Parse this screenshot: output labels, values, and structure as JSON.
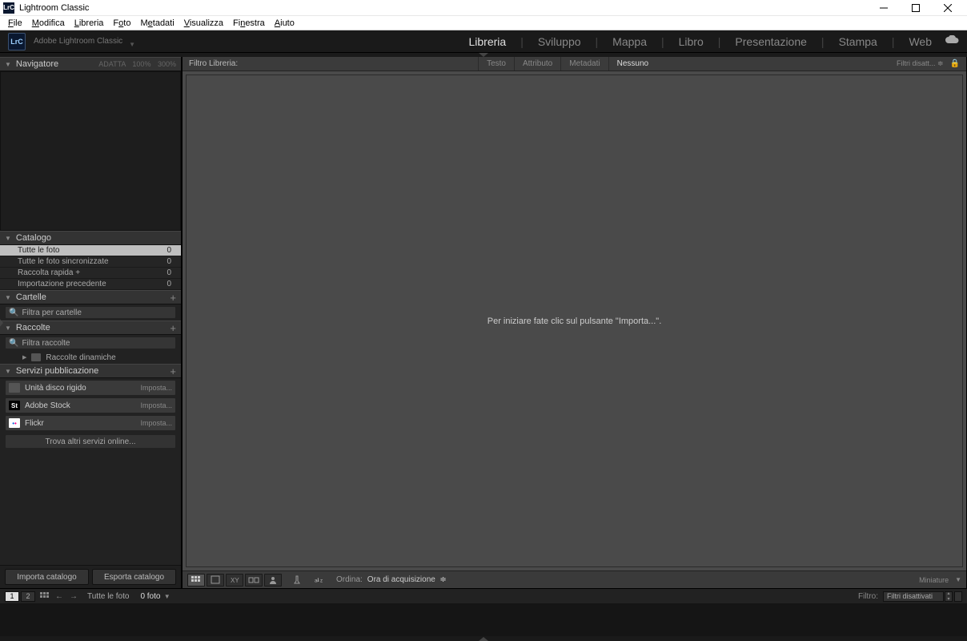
{
  "title": "Lightroom Classic",
  "menu": [
    "File",
    "Modifica",
    "Libreria",
    "Foto",
    "Metadati",
    "Visualizza",
    "Finestra",
    "Aiuto"
  ],
  "app_name": "Adobe Lightroom Classic",
  "modules": [
    "Libreria",
    "Sviluppo",
    "Mappa",
    "Libro",
    "Presentazione",
    "Stampa",
    "Web"
  ],
  "active_module": "Libreria",
  "navigator": {
    "title": "Navigatore",
    "zoom": [
      "ADATTA",
      "100%",
      "300%"
    ]
  },
  "catalog": {
    "title": "Catalogo",
    "items": [
      {
        "label": "Tutte le foto",
        "count": "0",
        "sel": true
      },
      {
        "label": "Tutte le foto sincronizzate",
        "count": "0"
      },
      {
        "label": "Raccolta rapida +",
        "count": "0"
      },
      {
        "label": "Importazione precedente",
        "count": "0"
      }
    ]
  },
  "folders": {
    "title": "Cartelle",
    "filter_ph": "Filtra per cartelle"
  },
  "collections": {
    "title": "Raccolte",
    "filter_ph": "Filtra raccolte",
    "smart": "Raccolte dinamiche"
  },
  "publish": {
    "title": "Servizi pubblicazione",
    "items": [
      {
        "label": "Unità disco rigido",
        "action": "Imposta...",
        "type": "hd"
      },
      {
        "label": "Adobe Stock",
        "action": "Imposta...",
        "type": "st"
      },
      {
        "label": "Flickr",
        "action": "Imposta...",
        "type": "fl"
      }
    ],
    "online": "Trova altri servizi online..."
  },
  "import_btn": "Importa catalogo",
  "export_btn": "Esporta catalogo",
  "filterbar": {
    "label": "Filtro Libreria:",
    "tabs": [
      "Testo",
      "Attributo",
      "Metadati",
      "Nessuno"
    ],
    "active": "Nessuno",
    "off": "Filtri disatt..."
  },
  "placeholder": "Per iniziare fate clic sul pulsante \"Importa...\".",
  "toolbar": {
    "sort_label": "Ordina:",
    "sort_value": "Ora di acquisizione",
    "thumb": "Miniature"
  },
  "filmstrip": {
    "source": "Tutte le foto",
    "count": "0 foto",
    "filter_label": "Filtro:",
    "filter_value": "Filtri disattivati"
  }
}
